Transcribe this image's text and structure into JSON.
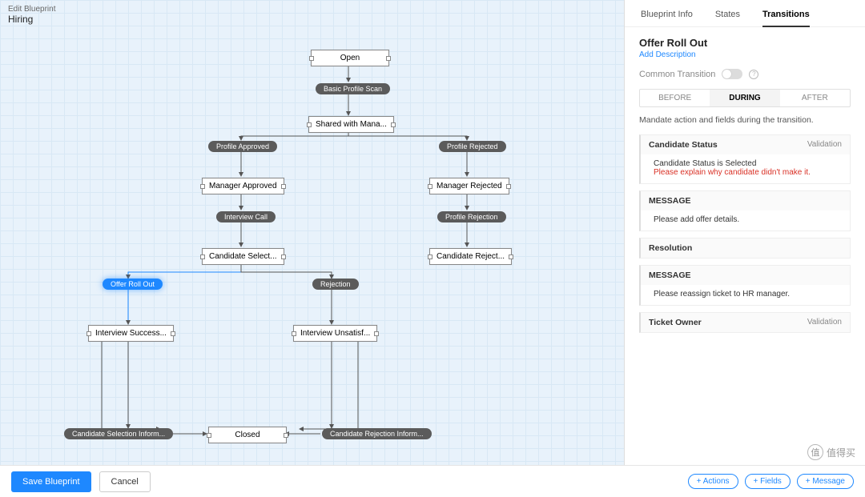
{
  "header": {
    "label": "Edit Blueprint",
    "name": "Hiring"
  },
  "nodes": {
    "open": "Open",
    "shared": "Shared with Mana...",
    "mgr_approved": "Manager Approved",
    "mgr_rejected": "Manager Rejected",
    "cand_select": "Candidate Select...",
    "cand_reject": "Candidate Reject...",
    "int_success": "Interview Success...",
    "int_unsat": "Interview Unsatisf...",
    "closed": "Closed"
  },
  "transitions": {
    "basic_scan": "Basic Profile Scan",
    "profile_approved": "Profile Approved",
    "profile_rejected": "Profile Rejected",
    "interview_call": "Interview Call",
    "profile_rejection": "Profile Rejection",
    "offer_roll_out": "Offer Roll Out",
    "rejection": "Rejection",
    "cand_sel_inform": "Candidate Selection Inform...",
    "cand_rej_inform": "Candidate Rejection Inform..."
  },
  "panel": {
    "tabs": {
      "info": "Blueprint Info",
      "states": "States",
      "transitions": "Transitions"
    },
    "title": "Offer Roll Out",
    "add_desc": "Add Description",
    "common": "Common Transition",
    "subtabs": {
      "before": "BEFORE",
      "during": "DURING",
      "after": "AFTER"
    },
    "mandate": "Mandate action and fields during the transition.",
    "fields": [
      {
        "name": "Candidate Status",
        "tag": "Validation",
        "lines": [
          "Candidate Status is Selected",
          "Please explain why candidate didn't make it."
        ],
        "err_idx": 1
      },
      {
        "name": "MESSAGE",
        "tag": "",
        "lines": [
          "Please add offer details."
        ]
      },
      {
        "name": "Resolution",
        "tag": "",
        "lines": []
      },
      {
        "name": "MESSAGE",
        "tag": "",
        "lines": [
          "Please reassign ticket to HR manager."
        ]
      },
      {
        "name": "Ticket Owner",
        "tag": "Validation",
        "lines": []
      }
    ]
  },
  "footer": {
    "save": "Save Blueprint",
    "cancel": "Cancel",
    "actions": "+ Actions",
    "fields": "+ Fields",
    "message": "+ Message"
  },
  "watermark": {
    "icon": "值",
    "text": "值得买"
  }
}
